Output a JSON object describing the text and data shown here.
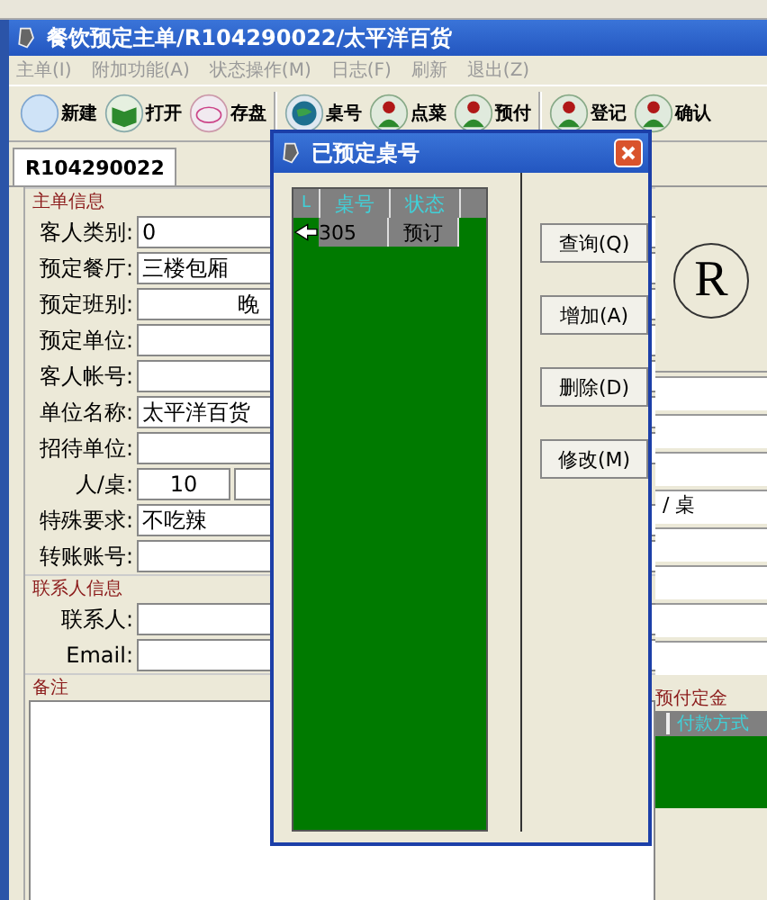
{
  "window": {
    "title": "餐饮预定主单/R104290022/太平洋百货"
  },
  "menu": [
    {
      "label": "主单(I)"
    },
    {
      "label": "附加功能(A)"
    },
    {
      "label": "状态操作(M)"
    },
    {
      "label": "日志(F)"
    },
    {
      "label": "刷新"
    },
    {
      "label": "退出(Z)"
    }
  ],
  "toolbar": [
    [
      {
        "label": "新建",
        "kind": "new"
      },
      {
        "label": "打开",
        "kind": "open"
      },
      {
        "label": "存盘",
        "kind": "save"
      }
    ],
    [
      {
        "label": "桌号",
        "kind": "globe"
      },
      {
        "label": "点菜",
        "kind": "person"
      },
      {
        "label": "预付",
        "kind": "person"
      }
    ],
    [
      {
        "label": "登记",
        "kind": "person"
      },
      {
        "label": "确认",
        "kind": "person"
      }
    ]
  ],
  "tabs": [
    {
      "label": "R104290022",
      "selected": true
    }
  ],
  "main_info": {
    "title": "主单信息",
    "fields": [
      {
        "label": "客人类别:",
        "value": "0",
        "kind": "text"
      },
      {
        "label": "预定餐厅:",
        "value": "三楼包厢",
        "kind": "text"
      },
      {
        "label": "预定班别:",
        "value": "晚",
        "kind": "indented"
      },
      {
        "label": "预定单位:",
        "kind": "text"
      },
      {
        "label": "客人帐号:",
        "kind": "text"
      },
      {
        "label": "单位名称:",
        "value": "太平洋百货",
        "kind": "text"
      },
      {
        "label": "招待单位:",
        "kind": "text"
      },
      {
        "label": "人/桌:",
        "value": "10",
        "kind": "pair"
      },
      {
        "label": "特殊要求:",
        "value": "不吃辣",
        "kind": "text"
      },
      {
        "label": "转账账号:",
        "kind": "text"
      }
    ]
  },
  "contact_info": {
    "title": "联系人信息",
    "fields": [
      {
        "label": "联系人:"
      },
      {
        "label": "Email:"
      }
    ]
  },
  "notes": {
    "title": "备注"
  },
  "side": {
    "mark": "R",
    "table_unit": "/ 桌",
    "deposit": {
      "title": "预付定金",
      "columns": [
        "付款方式"
      ]
    }
  },
  "dialog": {
    "title": "已预定桌号",
    "table": {
      "columns": [
        "L",
        "桌号",
        "状态"
      ],
      "rows": [
        {
          "cells": [
            "",
            "305",
            "预订"
          ],
          "selected": true
        }
      ]
    },
    "buttons": [
      {
        "label": "查询(Q)"
      },
      {
        "label": "增加(A)"
      },
      {
        "label": "删除(D)"
      },
      {
        "label": "修改(M)"
      }
    ]
  }
}
